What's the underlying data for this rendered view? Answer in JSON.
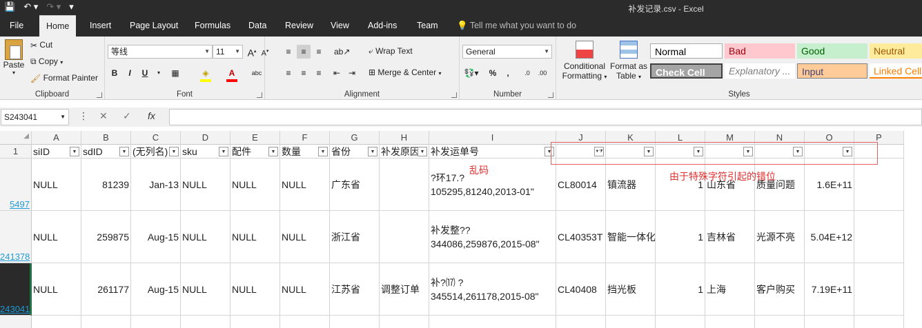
{
  "titlebar": {
    "title": "补发记录.csv  -  Excel"
  },
  "tabs": [
    "File",
    "Home",
    "Insert",
    "Page Layout",
    "Formulas",
    "Data",
    "Review",
    "View",
    "Add-ins",
    "Team"
  ],
  "tell_me": "Tell me what you want to do",
  "clipboard": {
    "paste": "Paste",
    "cut": "Cut",
    "copy": "Copy",
    "format_painter": "Format Painter",
    "label": "Clipboard"
  },
  "font": {
    "name": "等线",
    "size": "11",
    "label": "Font",
    "bold": "B",
    "italic": "I",
    "underline": "U",
    "grow": "A",
    "shrink": "A"
  },
  "alignment": {
    "wrap": "Wrap Text",
    "merge": "Merge & Center",
    "label": "Alignment"
  },
  "number": {
    "format": "General",
    "percent": "%",
    "comma": ",",
    "inc": ".0",
    "dec": ".00",
    "label": "Number"
  },
  "styles_group": {
    "conditional": "Conditional",
    "conditional2": "Formatting",
    "format_as": "Format as",
    "format_as2": "Table",
    "label": "Styles",
    "cells": [
      {
        "label": "Normal",
        "bg": "#ffffff",
        "fg": "#000000"
      },
      {
        "label": "Bad",
        "bg": "#ffc7ce",
        "fg": "#9c0006"
      },
      {
        "label": "Good",
        "bg": "#c6efce",
        "fg": "#006100"
      },
      {
        "label": "Neutral",
        "bg": "#ffeb9c",
        "fg": "#9c5700"
      },
      {
        "label": "Check Cell",
        "bg": "#a5a5a5",
        "fg": "#ffffff"
      },
      {
        "label": "Explanatory ...",
        "bg": "#ffffff",
        "fg": "#7f7f7f"
      },
      {
        "label": "Input",
        "bg": "#ffcc99",
        "fg": "#3f3f76"
      },
      {
        "label": "Linked Cell",
        "bg": "#ffffff",
        "fg": "#fa7d00"
      }
    ]
  },
  "namebox": "S243041",
  "fx": "fx",
  "columns": [
    "A",
    "B",
    "C",
    "D",
    "E",
    "F",
    "G",
    "H",
    "I",
    "J",
    "K",
    "L",
    "M",
    "N",
    "O",
    "P"
  ],
  "header_row_number": "1",
  "headers": [
    "siID",
    "sdID",
    "(无列名)",
    "sku",
    "配件",
    "数量",
    "省份",
    "补发原因",
    "补发运单号",
    "",
    "",
    "",
    "",
    "",
    "",
    ""
  ],
  "rows": [
    {
      "rownum": "5497",
      "cells": [
        "NULL",
        "81239",
        "Jan-13",
        "NULL",
        "NULL",
        "NULL",
        "广东省",
        "",
        "?环17.?",
        "CL80014",
        "镇流器",
        "1",
        "山东省",
        "质量问题",
        "1.6E+11",
        ""
      ],
      "line2": "105295,81240,2013-01\""
    },
    {
      "rownum": "241378",
      "cells": [
        "NULL",
        "259875",
        "Aug-15",
        "NULL",
        "NULL",
        "NULL",
        "浙江省",
        "",
        "补发整??",
        "CL40353T",
        "智能一体化",
        "1",
        "吉林省",
        "光源不亮",
        "5.04E+12",
        ""
      ],
      "line2": "344086,259876,2015-08\""
    },
    {
      "rownum": "243041",
      "cells": [
        "NULL",
        "261177",
        "Aug-15",
        "NULL",
        "NULL",
        "NULL",
        "江苏省",
        "调整订单",
        "补?⒄    ?",
        "CL40408",
        "挡光板",
        "1",
        "上海",
        "客户购买",
        "7.19E+11",
        ""
      ],
      "line2": "345514,261178,2015-08\""
    }
  ],
  "annotations": {
    "garbled": "乱码",
    "misaligned": "由于特殊字符引起的错位"
  }
}
